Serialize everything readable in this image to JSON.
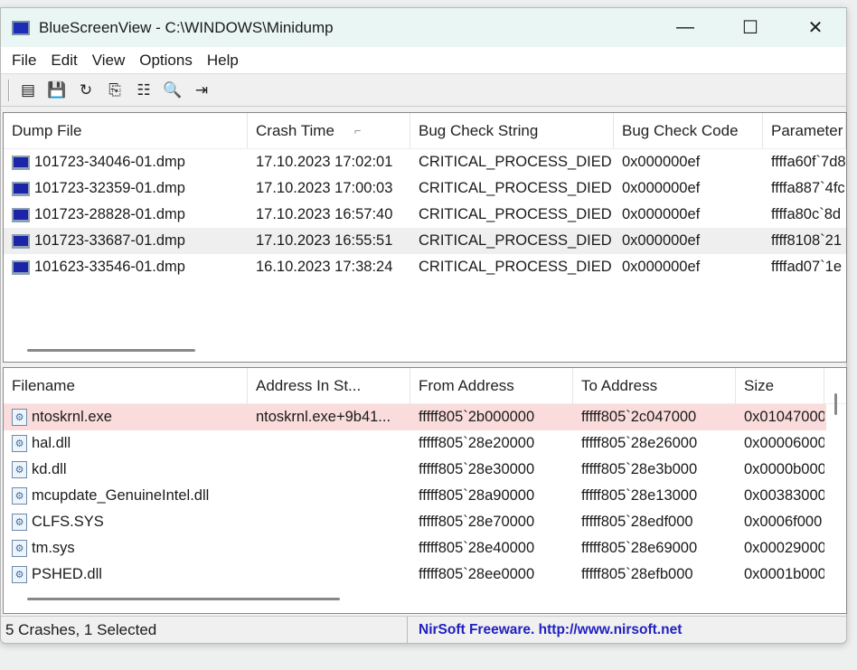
{
  "window": {
    "title": "BlueScreenView  -  C:\\WINDOWS\\Minidump",
    "minimize": "—",
    "maximize": "☐",
    "close": "✕"
  },
  "menu": [
    "File",
    "Edit",
    "View",
    "Options",
    "Help"
  ],
  "toolbar": [
    {
      "icon": "html-report-icon",
      "glyph": "▤"
    },
    {
      "icon": "save-icon",
      "glyph": "💾"
    },
    {
      "icon": "refresh-icon",
      "glyph": "↻"
    },
    {
      "icon": "copy-icon",
      "glyph": "⎘"
    },
    {
      "icon": "properties-icon",
      "glyph": "☷"
    },
    {
      "icon": "find-icon",
      "glyph": "🔍"
    },
    {
      "icon": "exit-icon",
      "glyph": "⇥"
    }
  ],
  "dumps": {
    "columns": [
      "Dump File",
      "Crash Time",
      "Bug Check String",
      "Bug Check Code",
      "Parameter"
    ],
    "sort_indicator": "⌐",
    "rows": [
      [
        "101723-34046-01.dmp",
        "17.10.2023 17:02:01",
        "CRITICAL_PROCESS_DIED",
        "0x000000ef",
        "ffffa60f`7d8"
      ],
      [
        "101723-32359-01.dmp",
        "17.10.2023 17:00:03",
        "CRITICAL_PROCESS_DIED",
        "0x000000ef",
        "ffffa887`4fc"
      ],
      [
        "101723-28828-01.dmp",
        "17.10.2023 16:57:40",
        "CRITICAL_PROCESS_DIED",
        "0x000000ef",
        "ffffa80c`8d"
      ],
      [
        "101723-33687-01.dmp",
        "17.10.2023 16:55:51",
        "CRITICAL_PROCESS_DIED",
        "0x000000ef",
        "ffff8108`21"
      ],
      [
        "101623-33546-01.dmp",
        "16.10.2023 17:38:24",
        "CRITICAL_PROCESS_DIED",
        "0x000000ef",
        "ffffad07`1e"
      ]
    ],
    "selected_index": 3
  },
  "drivers": {
    "columns": [
      "Filename",
      "Address In St...",
      "From Address",
      "To Address",
      "Size"
    ],
    "rows": [
      [
        "ntoskrnl.exe",
        "ntoskrnl.exe+9b41...",
        "fffff805`2b000000",
        "fffff805`2c047000",
        "0x01047000"
      ],
      [
        "hal.dll",
        "",
        "fffff805`28e20000",
        "fffff805`28e26000",
        "0x00006000"
      ],
      [
        "kd.dll",
        "",
        "fffff805`28e30000",
        "fffff805`28e3b000",
        "0x0000b000"
      ],
      [
        "mcupdate_GenuineIntel.dll",
        "",
        "fffff805`28a90000",
        "fffff805`28e13000",
        "0x00383000"
      ],
      [
        "CLFS.SYS",
        "",
        "fffff805`28e70000",
        "fffff805`28edf000",
        "0x0006f000"
      ],
      [
        "tm.sys",
        "",
        "fffff805`28e40000",
        "fffff805`28e69000",
        "0x00029000"
      ],
      [
        "PSHED.dll",
        "",
        "fffff805`28ee0000",
        "fffff805`28efb000",
        "0x0001b000"
      ]
    ],
    "highlighted_index": 0
  },
  "status": {
    "count": "5 Crashes, 1 Selected",
    "credit": "NirSoft Freeware.  http://www.nirsoft.net"
  }
}
